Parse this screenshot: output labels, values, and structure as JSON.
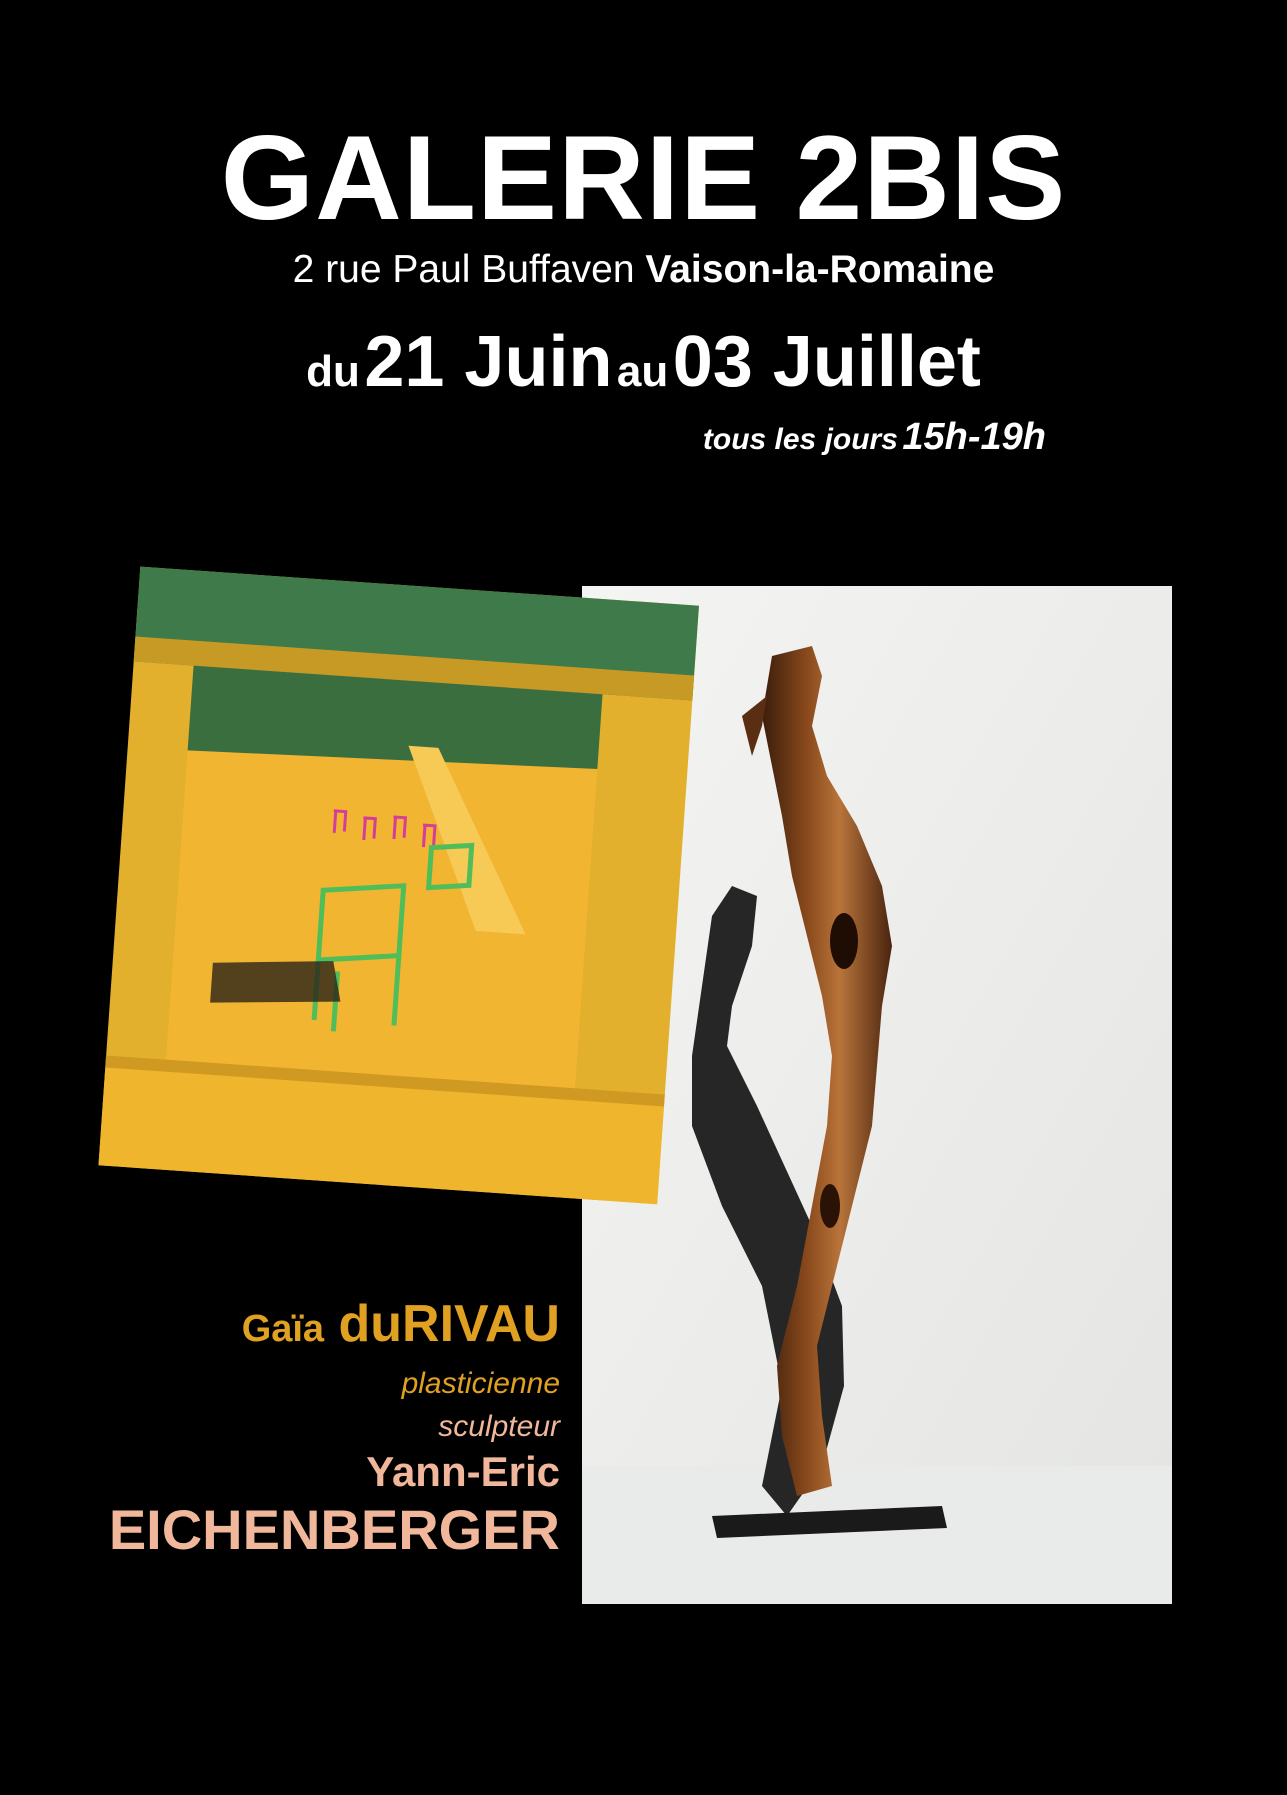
{
  "poster": {
    "title": "GALERIE 2BIS",
    "address": {
      "street": "2 rue Paul Buffaven",
      "city": "Vaison-la-Romaine"
    },
    "dates": {
      "prefix": "du",
      "start": "21 Juin",
      "connector": "au",
      "end": "03 Juillet"
    },
    "hours": {
      "label": "tous les jours",
      "times": "15h-19h"
    },
    "artists": {
      "artist1_first": "Gaïa",
      "artist1_last": "duRIVAU",
      "artist1_role": "plasticienne",
      "artist2_role": "sculpteur",
      "artist2_first": "Yann-Eric",
      "artist2_last": "EICHENBERGER"
    },
    "colors": {
      "background": "#000000",
      "artist1": "#e0a021",
      "artist2": "#f1b79a"
    },
    "images": [
      "painting-yellow-chairs",
      "olive-wood-sculpture"
    ]
  }
}
